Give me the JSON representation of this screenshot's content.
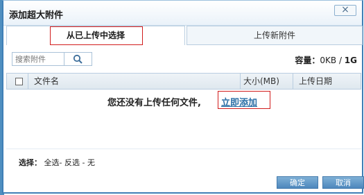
{
  "dialog": {
    "title": "添加超大附件",
    "close_symbol": "×"
  },
  "tabs": [
    {
      "label": "从已上传中选择",
      "active": true
    },
    {
      "label": "上传新附件",
      "active": false
    }
  ],
  "search": {
    "placeholder": "搜索附件",
    "value": ""
  },
  "capacity": {
    "label": "容量：",
    "used": "0KB",
    "separator": " / ",
    "total": "1G"
  },
  "table": {
    "columns": [
      "文件名",
      "大小(MB)",
      "上传日期"
    ],
    "rows": []
  },
  "empty": {
    "message": "您还没有上传任何文件,",
    "add_link": "立即添加"
  },
  "select": {
    "label": "选择：",
    "all": "全选",
    "invert": "反选",
    "none": "无",
    "sep1": "-",
    "sep2": " - "
  },
  "buttons": {
    "ok": "确定",
    "cancel": "取消"
  }
}
